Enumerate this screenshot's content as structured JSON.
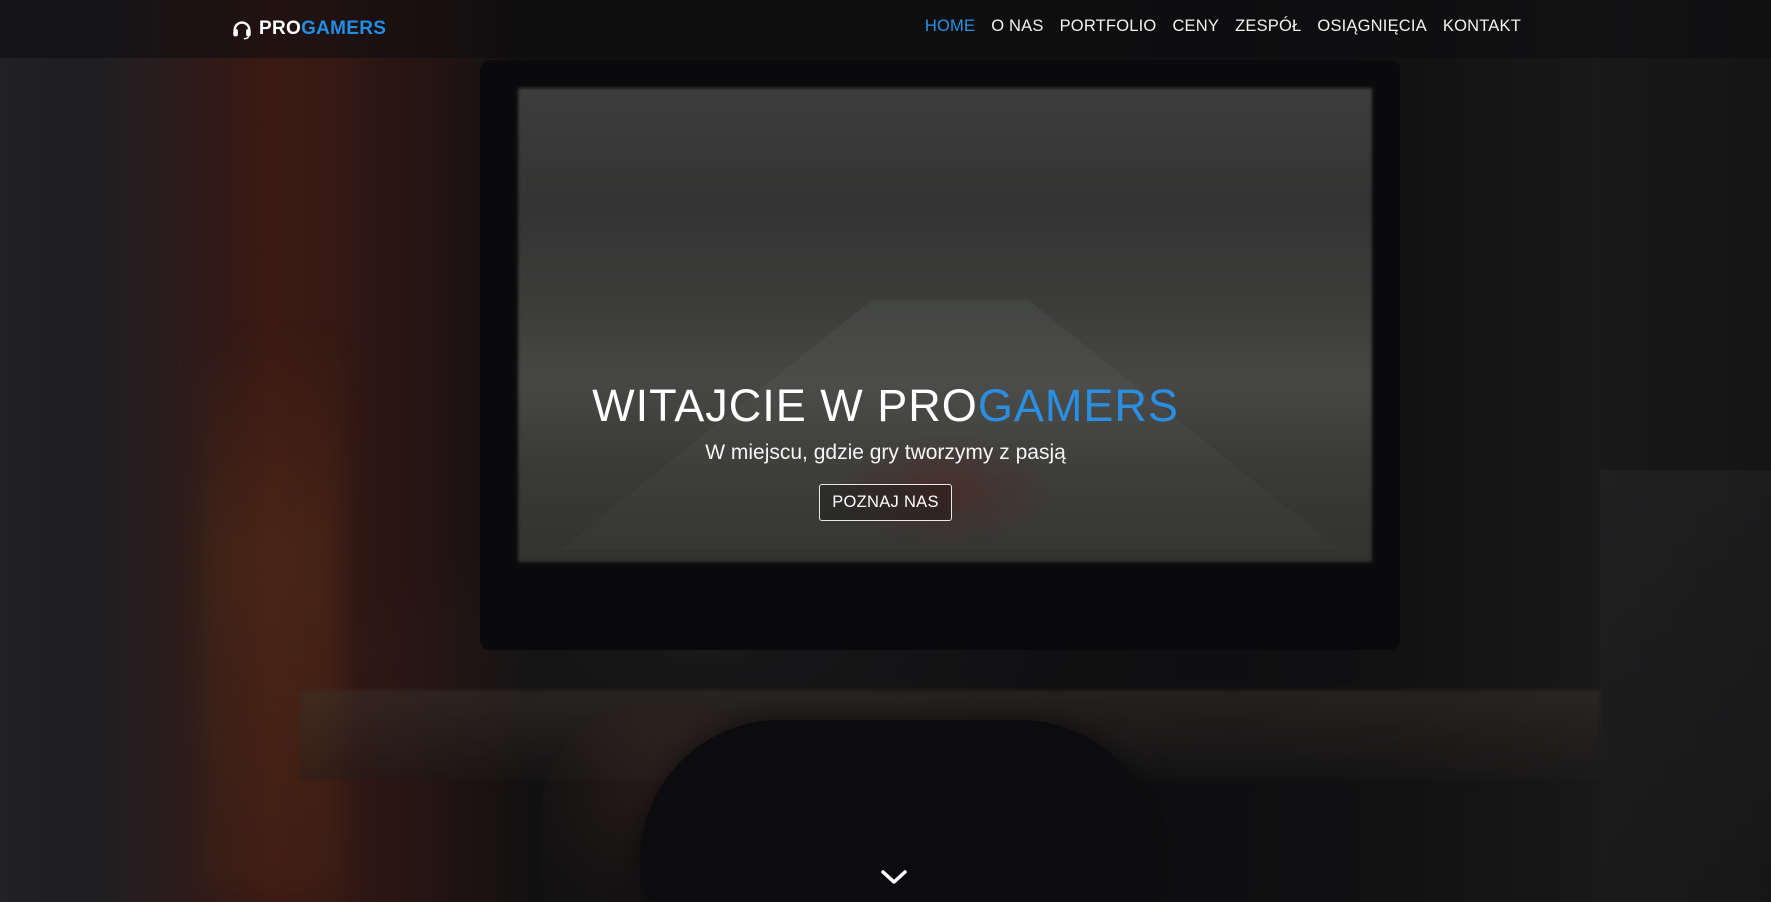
{
  "brand": {
    "prefix": "PRO",
    "accent": "GAMERS",
    "icon": "headset-icon"
  },
  "nav": {
    "items": [
      {
        "label": "HOME",
        "active": true
      },
      {
        "label": "O NAS",
        "active": false
      },
      {
        "label": "PORTFOLIO",
        "active": false
      },
      {
        "label": "CENY",
        "active": false
      },
      {
        "label": "ZESPÓŁ",
        "active": false
      },
      {
        "label": "OSIĄGNIĘCIA",
        "active": false
      },
      {
        "label": "KONTAKT",
        "active": false
      }
    ]
  },
  "hero": {
    "title_prefix": "WITAJCIE W PRO",
    "title_accent": "GAMERS",
    "subtitle": "W miejscu, gdzie gry tworzymy z pasją",
    "button_label": "POZNAJ NAS",
    "scroll_icon": "chevron-down-icon"
  },
  "colors": {
    "accent": "#1f8fe8",
    "text": "#ffffff",
    "overlay": "#0d0d10"
  }
}
